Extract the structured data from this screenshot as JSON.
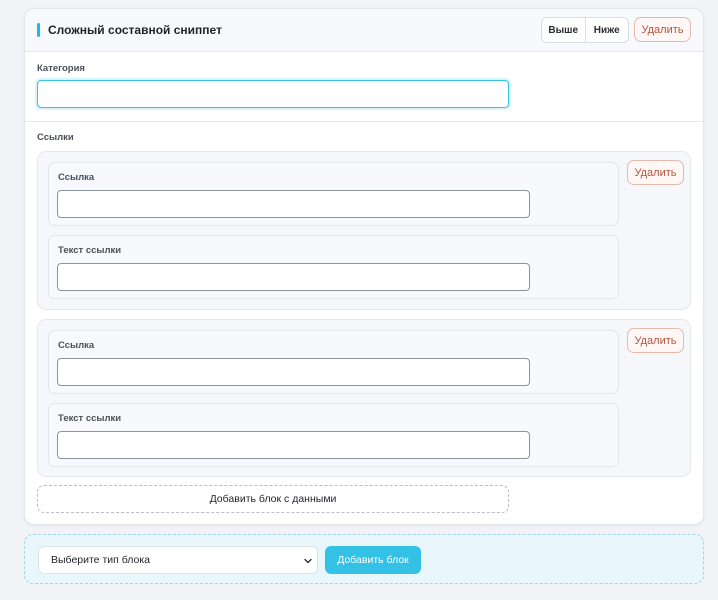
{
  "snippet": {
    "title": "Сложный составной сниппет",
    "up_label": "Выше",
    "down_label": "Ниже",
    "delete_label": "Удалить"
  },
  "category": {
    "label": "Категория",
    "value": ""
  },
  "links": {
    "section_label": "Ссылки",
    "items": [
      {
        "url_label": "Ссылка",
        "url_value": "",
        "text_label": "Текст ссылки",
        "text_value": "",
        "delete_label": "Удалить"
      },
      {
        "url_label": "Ссылка",
        "url_value": "",
        "text_label": "Текст ссылки",
        "text_value": "",
        "delete_label": "Удалить"
      }
    ],
    "add_data_block_label": "Добавить блок с данными"
  },
  "footer": {
    "select_label": "Выберите тип блока",
    "add_block_label": "Добавить блок"
  },
  "colors": {
    "accent": "#22b8d9",
    "primary_button": "#33c1e6",
    "danger": "#b4533b",
    "focus_border": "#35c3e0"
  }
}
